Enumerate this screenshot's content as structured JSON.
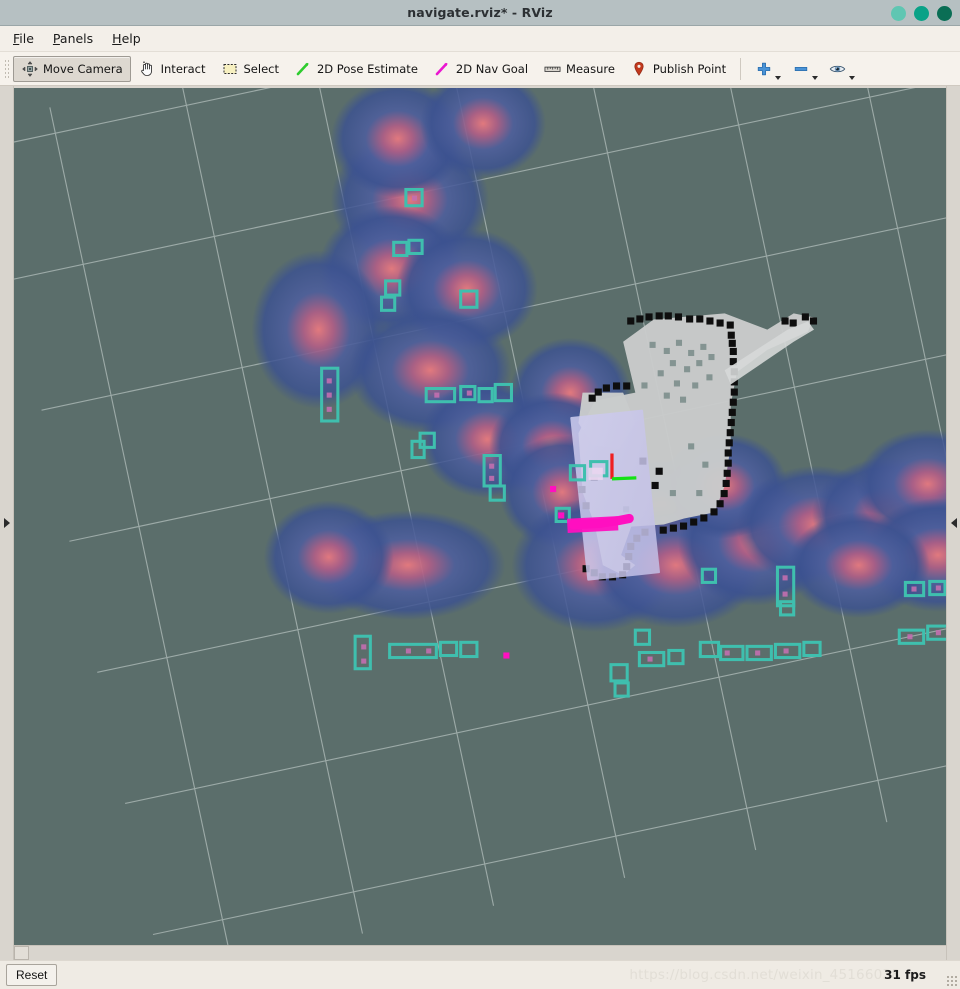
{
  "window": {
    "title": "navigate.rviz* - RViz",
    "controls": [
      {
        "name": "minimize",
        "color": "#5fc6b2"
      },
      {
        "name": "maximize",
        "color": "#0aa287"
      },
      {
        "name": "close",
        "color": "#0a6e55"
      }
    ]
  },
  "menubar": {
    "items": [
      {
        "mnemonic": "F",
        "rest": "ile",
        "name": "file"
      },
      {
        "mnemonic": "P",
        "rest": "anels",
        "name": "panels"
      },
      {
        "mnemonic": "H",
        "rest": "elp",
        "name": "help"
      }
    ]
  },
  "toolbar": {
    "tools": [
      {
        "label": "Move Camera",
        "icon": "move-camera-icon",
        "checked": true
      },
      {
        "label": "Interact",
        "icon": "interact-hand-icon",
        "checked": false
      },
      {
        "label": "Select",
        "icon": "select-rectangle-icon",
        "checked": false
      },
      {
        "label": "2D Pose Estimate",
        "icon": "pose-estimate-arrow-icon",
        "checked": false
      },
      {
        "label": "2D Nav Goal",
        "icon": "nav-goal-arrow-icon",
        "checked": false
      },
      {
        "label": "Measure",
        "icon": "measure-ruler-icon",
        "checked": false
      },
      {
        "label": "Publish Point",
        "icon": "publish-point-pin-icon",
        "checked": false
      }
    ],
    "icon_buttons": [
      {
        "name": "add-tool-button",
        "icon": "plus-icon",
        "has_caret": true
      },
      {
        "name": "remove-tool-button",
        "icon": "minus-icon",
        "has_caret": true
      },
      {
        "name": "visibility-button",
        "icon": "eye-icon",
        "has_caret": true
      }
    ],
    "colors": {
      "pose_estimate": "#2ecc2e",
      "nav_goal": "#ea17d0",
      "publish_point": "#c2381c",
      "icon_blue": "#2c7fc4"
    }
  },
  "panels": {
    "left_splitter_arrow": "chevron-right-icon",
    "right_splitter_arrow": "chevron-left-icon"
  },
  "statusbar": {
    "reset_label": "Reset",
    "fps": "31 fps",
    "watermark": "https://blog.csdn.net/weixin_45166038"
  },
  "scene": {
    "background_color": "#5b6e6b",
    "grid_color": "#c9d2d0",
    "map_free_color": "#c9cbcb",
    "map_occupied_color": "#111111",
    "local_costmap_color": "#c8c6ea",
    "inflation_color": "#3f5590",
    "lethal_core_color": "#d4606a",
    "obstacle_cell_color": "#3fbfae",
    "path_color": "#ff10c0",
    "axis_x_color": "#ef2020",
    "axis_y_color": "#14e214"
  }
}
